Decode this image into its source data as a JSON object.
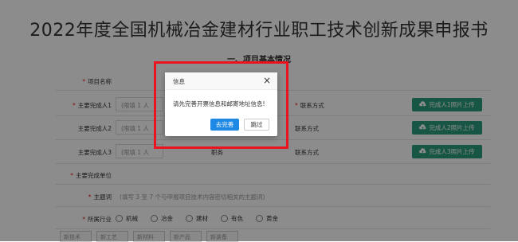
{
  "document": {
    "title": "2022年度全国机械冶金建材行业职工技术创新成果申报书",
    "section_title": "一、项目基本情况"
  },
  "form": {
    "project_name_label": "项目名称",
    "main_person1_label": "主要完成人1",
    "main_person1_placeholder": "(限填 1 人",
    "main_person2_label": "主要完成人2",
    "main_person2_placeholder": "(限填 1 人",
    "main_person3_label": "主要完成人3",
    "main_person3_placeholder": "(限填 1 人",
    "contact_label": "联系方式",
    "position_label": "职务",
    "upload1_label": "完成人1照片上传",
    "upload2_label": "完成人2照片上传",
    "upload3_label": "完成人3照片上传",
    "main_unit_label": "主要完成单位",
    "theme_label": "主题词",
    "theme_hint": "(填写 3 至 7 个与申报项目技术内容密切相关的主题词)",
    "industry_label": "所属行业",
    "industry_options": [
      "机械",
      "冶金",
      "建材",
      "有色",
      "黄金"
    ],
    "tags": [
      "新技术",
      "新工艺",
      "新材料",
      "新产品",
      "新装备"
    ]
  },
  "dialog": {
    "title": "信息",
    "close_symbol": "×",
    "message": "请先完善开票信息和邮寄地址信息!",
    "confirm_label": "去完善",
    "skip_label": "跳过"
  },
  "colors": {
    "upload_button": "#2a9d7f",
    "primary_button": "#1e88e5",
    "highlight_border": "#e8151f",
    "required_mark": "#e02020"
  }
}
